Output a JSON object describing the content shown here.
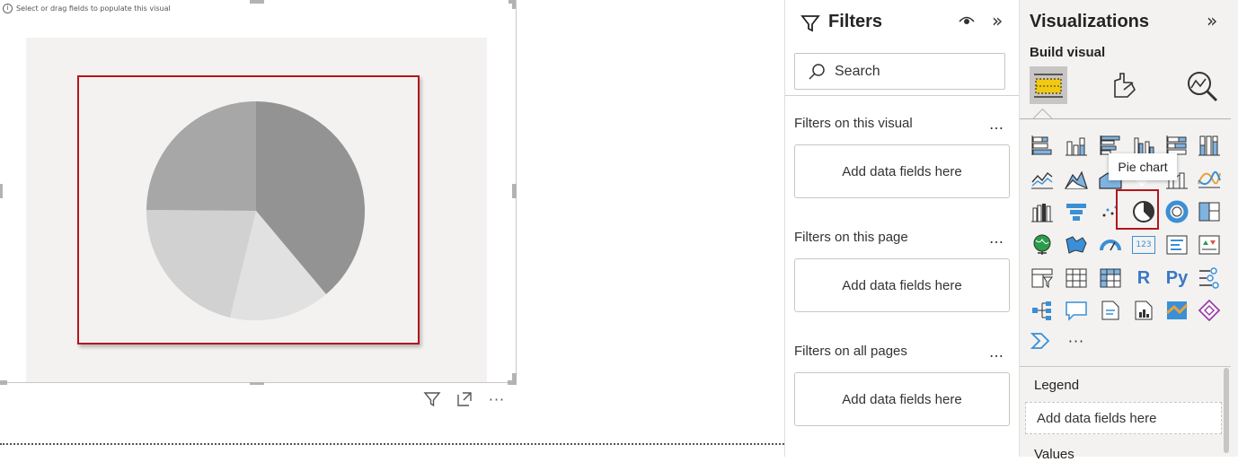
{
  "canvas": {
    "hint_text": "Select or drag fields to populate this visual",
    "placeholder_visual": "pie chart",
    "pie_colors": [
      "#939393",
      "#e1e1e1",
      "#d1d1d1",
      "#a7a7a8"
    ],
    "highlight_color": "#b3161c"
  },
  "filters": {
    "title": "Filters",
    "search_placeholder": "Search",
    "sections": [
      {
        "label": "Filters on this visual",
        "drop_text": "Add data fields here"
      },
      {
        "label": "Filters on this page",
        "drop_text": "Add data fields here"
      },
      {
        "label": "Filters on all pages",
        "drop_text": "Add data fields here"
      }
    ],
    "more": "…"
  },
  "visualizations": {
    "title": "Visualizations",
    "build_visual": "Build visual",
    "tooltip": "Pie chart",
    "more_visuals": "···",
    "wells": {
      "legend_label": "Legend",
      "legend_drop": "Add data fields here",
      "values_label": "Values"
    }
  },
  "icons": {
    "r_visual_glyph": "R",
    "python_visual_glyph": "Py",
    "card_glyph": "123",
    "collapse_glyph": "»"
  }
}
